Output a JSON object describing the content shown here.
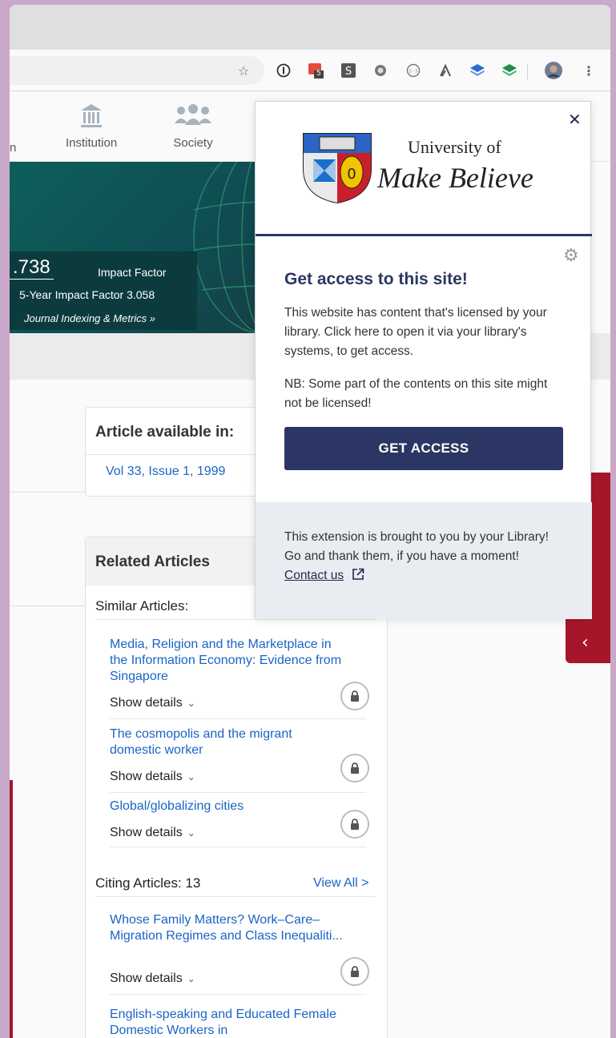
{
  "browser": {
    "extensions": {
      "badge_count": "5"
    }
  },
  "nav": {
    "partial_item": "n",
    "institution": "Institution",
    "society": "Society"
  },
  "metrics": {
    "impact_value": ".738",
    "impact_label": "Impact Factor",
    "five_year": "5-Year Impact Factor 3.058",
    "indexing_link": "Journal Indexing & Metrics »"
  },
  "article_available": {
    "heading": "Article available in:",
    "link": "Vol 33, Issue 1, 1999"
  },
  "related": {
    "heading": "Related Articles",
    "similar_heading": "Similar Articles:",
    "show_details": "Show details",
    "similar": [
      {
        "title": "Media, Religion and the Marketplace in the Information Economy: Evidence from Singapore"
      },
      {
        "title": "The cosmopolis and the migrant domestic worker"
      },
      {
        "title": "Global/globalizing cities"
      }
    ],
    "citing_heading": "Citing Articles: 13",
    "view_all": "View All >",
    "citing": [
      {
        "title": "Whose Family Matters? Work–Care–Migration Regimes and Class Inequaliti..."
      },
      {
        "title": "English-speaking and Educated Female Domestic Workers in"
      }
    ]
  },
  "popup": {
    "uni_of": "University of",
    "uni_name": "Make Believe",
    "title": "Get access to this site!",
    "body1": "This website has content that's licensed by your library. Click here to open it via your library's systems, to get access.",
    "body2": "NB: Some part of the contents on this site might not be licensed!",
    "button": "GET ACCESS",
    "footer": "This extension is brought to you by your Library! Go and thank them, if you have a moment!",
    "contact": "Contact us"
  },
  "colors": {
    "navy": "#2a3762",
    "red": "#a6162a",
    "link_blue": "#1a64c4",
    "teal": "#0d5f5b"
  }
}
